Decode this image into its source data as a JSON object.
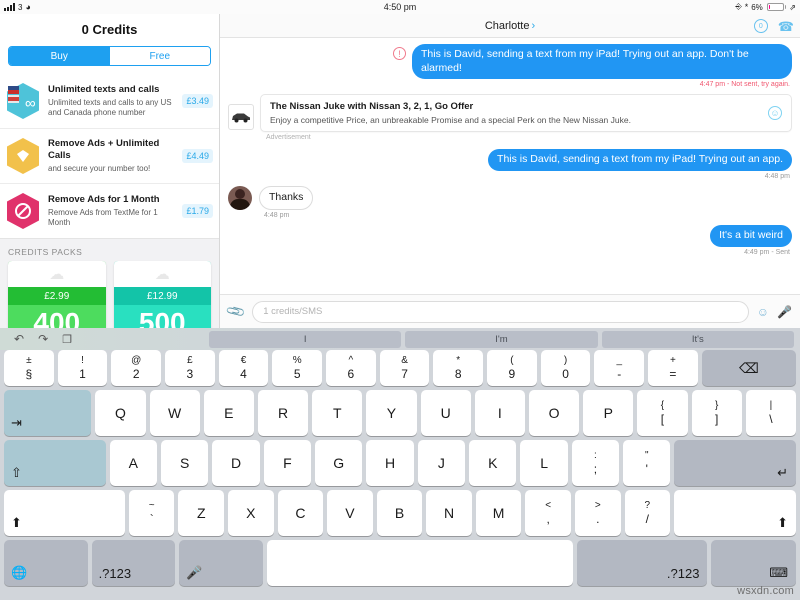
{
  "status_bar": {
    "signal_label": "3",
    "wifi_icon": "wifi-icon",
    "time": "4:50 pm",
    "battery_percent": "6%",
    "orientation_lock_icon": "rotation-lock-icon",
    "bluetooth_icon": "bluetooth-icon",
    "charging_icon": "charging-bolt-icon"
  },
  "store": {
    "title": "0 Credits",
    "tabs": [
      {
        "label": "Buy",
        "active": true
      },
      {
        "label": "Free",
        "active": false
      }
    ],
    "products": [
      {
        "title": "Unlimited texts and calls",
        "subtitle": "Unlimited texts and calls to any US and Canada phone number",
        "price": "£3.49",
        "icon": "infinity-hex-icon",
        "icon_color": "#4ec3d9"
      },
      {
        "title": "Remove Ads + Unlimited Calls",
        "subtitle": "and secure your number too!",
        "price": "£4.49",
        "icon": "diamond-hex-icon",
        "icon_color": "#f2c14b"
      },
      {
        "title": "Remove Ads for 1 Month",
        "subtitle": "Remove Ads from TextMe for 1 Month",
        "price": "£1.79",
        "icon": "no-ads-hex-icon",
        "icon_color": "#e0326b"
      }
    ],
    "packs_header": "CREDITS PACKS",
    "packs": [
      {
        "price": "£2.99",
        "amount": "400",
        "color": "#4ddc5e",
        "header_color": "#23bd34",
        "cloud_icon": "cloud-icon"
      },
      {
        "price": "£12.99",
        "amount": "500",
        "color": "#29e0c0",
        "header_color": "#13c4a8",
        "cloud_icon": "cloud-icon"
      }
    ]
  },
  "chat": {
    "contact_name": "Charlotte",
    "chevron": "›",
    "credits_badge": "0",
    "call_icon": "phone-icon",
    "info_icon": "credits-circle-icon",
    "messages": [
      {
        "type": "outgoing-error",
        "text": "This is David, sending a text from my iPad! Trying out an app. Don't be alarmed!",
        "meta": "4:47 pm - Not sent, try again.",
        "error_icon": "exclamation-circle-icon"
      },
      {
        "type": "ad",
        "title": "The Nissan Juke with Nissan 3, 2, 1, Go Offer",
        "desc": "Enjoy a competitive Price, an unbreakable Promise and a special Perk on the New Nissan Juke.",
        "label": "Advertisement",
        "thumb_icon": "car-icon",
        "action_icon": "smiley-download-icon"
      },
      {
        "type": "outgoing",
        "text": "This is David, sending a text from my iPad! Trying out an app.",
        "meta": "4:48 pm"
      },
      {
        "type": "incoming",
        "text": "Thanks",
        "meta": "4:48 pm",
        "avatar_icon": "contact-avatar"
      },
      {
        "type": "outgoing",
        "text": "It's a bit weird",
        "meta": "4:49 pm - Sent"
      }
    ],
    "input": {
      "placeholder": "1 credits/SMS",
      "value": "",
      "attach_icon": "paperclip-icon",
      "emoji_icon": "smiley-icon",
      "mic_icon": "microphone-icon"
    }
  },
  "keyboard": {
    "toolbar": {
      "undo_icon": "undo-icon",
      "redo_icon": "redo-icon",
      "copy_icon": "copy-icon"
    },
    "predictions": [
      "I",
      "I'm",
      "It's"
    ],
    "row_numbers": [
      {
        "up": "±",
        "lo": "§"
      },
      {
        "up": "!",
        "lo": "1"
      },
      {
        "up": "@",
        "lo": "2"
      },
      {
        "up": "£",
        "lo": "3"
      },
      {
        "up": "€",
        "lo": "4"
      },
      {
        "up": "%",
        "lo": "5"
      },
      {
        "up": "^",
        "lo": "6"
      },
      {
        "up": "&",
        "lo": "7"
      },
      {
        "up": "*",
        "lo": "8"
      },
      {
        "up": "(",
        "lo": "9"
      },
      {
        "up": ")",
        "lo": "0"
      },
      {
        "up": "_",
        "lo": "-"
      },
      {
        "up": "+",
        "lo": "="
      }
    ],
    "backspace_icon": "backspace-icon",
    "row_q": [
      "Q",
      "W",
      "E",
      "R",
      "T",
      "Y",
      "U",
      "I",
      "O",
      "P"
    ],
    "row_q_extra": [
      {
        "up": "{",
        "lo": "["
      },
      {
        "up": "}",
        "lo": "]"
      },
      {
        "up": "|",
        "lo": "\\"
      }
    ],
    "tab_icon": "tab-icon",
    "row_a": [
      "A",
      "S",
      "D",
      "F",
      "G",
      "H",
      "J",
      "K",
      "L"
    ],
    "row_a_extra": [
      {
        "up": ":",
        "lo": ";"
      },
      {
        "up": "\"",
        "lo": "'"
      }
    ],
    "capslock_icon": "capslock-icon",
    "return_icon": "return-icon",
    "row_z": [
      "Z",
      "X",
      "C",
      "V",
      "B",
      "N",
      "M"
    ],
    "row_z_extra": [
      {
        "up": "<",
        "lo": ","
      },
      {
        "up": ">",
        "lo": "."
      },
      {
        "up": "?",
        "lo": "/"
      }
    ],
    "shift_icon": "shift-icon",
    "bottom": {
      "globe_icon": "globe-icon",
      "numbers_left_label": ".?123",
      "dictation_icon": "microphone-icon",
      "space_label": "",
      "numbers_right_label": ".?123",
      "hide_keyboard_icon": "hide-keyboard-icon"
    }
  },
  "watermark": "wsxdn.com"
}
